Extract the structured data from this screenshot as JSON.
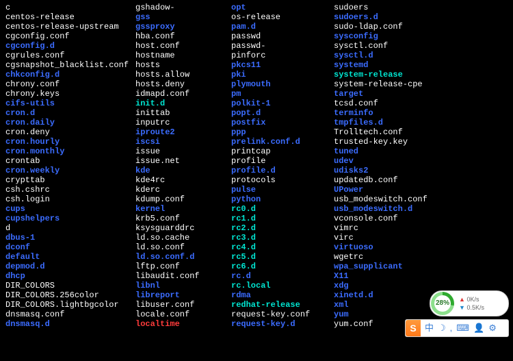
{
  "columns": [
    [
      {
        "name": "c",
        "type": "file"
      },
      {
        "name": "centos-release",
        "type": "file"
      },
      {
        "name": "centos-release-upstream",
        "type": "file"
      },
      {
        "name": "cgconfig.conf",
        "type": "file"
      },
      {
        "name": "cgconfig.d",
        "type": "dir"
      },
      {
        "name": "cgrules.conf",
        "type": "file"
      },
      {
        "name": "cgsnapshot_blacklist.conf",
        "type": "file"
      },
      {
        "name": "chkconfig.d",
        "type": "dir"
      },
      {
        "name": "chrony.conf",
        "type": "file"
      },
      {
        "name": "chrony.keys",
        "type": "file"
      },
      {
        "name": "cifs-utils",
        "type": "dir"
      },
      {
        "name": "cron.d",
        "type": "dir"
      },
      {
        "name": "cron.daily",
        "type": "dir"
      },
      {
        "name": "cron.deny",
        "type": "file"
      },
      {
        "name": "cron.hourly",
        "type": "dir"
      },
      {
        "name": "cron.monthly",
        "type": "dir"
      },
      {
        "name": "crontab",
        "type": "file"
      },
      {
        "name": "cron.weekly",
        "type": "dir"
      },
      {
        "name": "crypttab",
        "type": "file"
      },
      {
        "name": "csh.cshrc",
        "type": "file"
      },
      {
        "name": "csh.login",
        "type": "file"
      },
      {
        "name": "cups",
        "type": "dir"
      },
      {
        "name": "cupshelpers",
        "type": "dir"
      },
      {
        "name": "d",
        "type": "file"
      },
      {
        "name": "dbus-1",
        "type": "dir"
      },
      {
        "name": "dconf",
        "type": "dir"
      },
      {
        "name": "default",
        "type": "dir"
      },
      {
        "name": "depmod.d",
        "type": "dir"
      },
      {
        "name": "dhcp",
        "type": "dir"
      },
      {
        "name": "DIR_COLORS",
        "type": "file"
      },
      {
        "name": "DIR_COLORS.256color",
        "type": "file"
      },
      {
        "name": "DIR_COLORS.lightbgcolor",
        "type": "file"
      },
      {
        "name": "dnsmasq.conf",
        "type": "file"
      },
      {
        "name": "dnsmasq.d",
        "type": "dir"
      }
    ],
    [
      {
        "name": "gshadow-",
        "type": "file"
      },
      {
        "name": "gss",
        "type": "dir"
      },
      {
        "name": "gssproxy",
        "type": "dir"
      },
      {
        "name": "hba.conf",
        "type": "file"
      },
      {
        "name": "host.conf",
        "type": "file"
      },
      {
        "name": "hostname",
        "type": "file"
      },
      {
        "name": "hosts",
        "type": "file"
      },
      {
        "name": "hosts.allow",
        "type": "file"
      },
      {
        "name": "hosts.deny",
        "type": "file"
      },
      {
        "name": "idmapd.conf",
        "type": "file"
      },
      {
        "name": "init.d",
        "type": "link"
      },
      {
        "name": "inittab",
        "type": "file"
      },
      {
        "name": "inputrc",
        "type": "file"
      },
      {
        "name": "iproute2",
        "type": "dir"
      },
      {
        "name": "iscsi",
        "type": "dir"
      },
      {
        "name": "issue",
        "type": "file"
      },
      {
        "name": "issue.net",
        "type": "file"
      },
      {
        "name": "kde",
        "type": "dir"
      },
      {
        "name": "kde4rc",
        "type": "file"
      },
      {
        "name": "kderc",
        "type": "file"
      },
      {
        "name": "kdump.conf",
        "type": "file"
      },
      {
        "name": "kernel",
        "type": "dir"
      },
      {
        "name": "krb5.conf",
        "type": "file"
      },
      {
        "name": "ksysguarddrc",
        "type": "file"
      },
      {
        "name": "ld.so.cache",
        "type": "file"
      },
      {
        "name": "ld.so.conf",
        "type": "file"
      },
      {
        "name": "ld.so.conf.d",
        "type": "dir"
      },
      {
        "name": "lftp.conf",
        "type": "file"
      },
      {
        "name": "libaudit.conf",
        "type": "file"
      },
      {
        "name": "libnl",
        "type": "dir"
      },
      {
        "name": "libreport",
        "type": "dir"
      },
      {
        "name": "libuser.conf",
        "type": "file"
      },
      {
        "name": "locale.conf",
        "type": "file"
      },
      {
        "name": "localtime",
        "type": "orphan"
      }
    ],
    [
      {
        "name": "opt",
        "type": "dir"
      },
      {
        "name": "os-release",
        "type": "file"
      },
      {
        "name": "pam.d",
        "type": "dir"
      },
      {
        "name": "passwd",
        "type": "file"
      },
      {
        "name": "passwd-",
        "type": "file"
      },
      {
        "name": "pinforc",
        "type": "file"
      },
      {
        "name": "pkcs11",
        "type": "dir"
      },
      {
        "name": "pki",
        "type": "dir"
      },
      {
        "name": "plymouth",
        "type": "dir"
      },
      {
        "name": "pm",
        "type": "dir"
      },
      {
        "name": "polkit-1",
        "type": "dir"
      },
      {
        "name": "popt.d",
        "type": "dir"
      },
      {
        "name": "postfix",
        "type": "dir"
      },
      {
        "name": "ppp",
        "type": "dir"
      },
      {
        "name": "prelink.conf.d",
        "type": "dir"
      },
      {
        "name": "printcap",
        "type": "file"
      },
      {
        "name": "profile",
        "type": "file"
      },
      {
        "name": "profile.d",
        "type": "dir"
      },
      {
        "name": "protocols",
        "type": "file"
      },
      {
        "name": "pulse",
        "type": "dir"
      },
      {
        "name": "python",
        "type": "dir"
      },
      {
        "name": "rc0.d",
        "type": "link"
      },
      {
        "name": "rc1.d",
        "type": "link"
      },
      {
        "name": "rc2.d",
        "type": "link"
      },
      {
        "name": "rc3.d",
        "type": "link"
      },
      {
        "name": "rc4.d",
        "type": "link"
      },
      {
        "name": "rc5.d",
        "type": "link"
      },
      {
        "name": "rc6.d",
        "type": "link"
      },
      {
        "name": "rc.d",
        "type": "dir"
      },
      {
        "name": "rc.local",
        "type": "link"
      },
      {
        "name": "rdma",
        "type": "dir"
      },
      {
        "name": "redhat-release",
        "type": "link"
      },
      {
        "name": "request-key.conf",
        "type": "file"
      },
      {
        "name": "request-key.d",
        "type": "dir"
      }
    ],
    [
      {
        "name": "sudoers",
        "type": "file"
      },
      {
        "name": "sudoers.d",
        "type": "dir"
      },
      {
        "name": "sudo-ldap.conf",
        "type": "file"
      },
      {
        "name": "sysconfig",
        "type": "dir"
      },
      {
        "name": "sysctl.conf",
        "type": "file"
      },
      {
        "name": "sysctl.d",
        "type": "dir"
      },
      {
        "name": "systemd",
        "type": "dir"
      },
      {
        "name": "system-release",
        "type": "link"
      },
      {
        "name": "system-release-cpe",
        "type": "file"
      },
      {
        "name": "target",
        "type": "dir"
      },
      {
        "name": "tcsd.conf",
        "type": "file"
      },
      {
        "name": "terminfo",
        "type": "dir"
      },
      {
        "name": "tmpfiles.d",
        "type": "dir"
      },
      {
        "name": "Trolltech.conf",
        "type": "file"
      },
      {
        "name": "trusted-key.key",
        "type": "file"
      },
      {
        "name": "tuned",
        "type": "dir"
      },
      {
        "name": "udev",
        "type": "dir"
      },
      {
        "name": "udisks2",
        "type": "dir"
      },
      {
        "name": "updatedb.conf",
        "type": "file"
      },
      {
        "name": "UPower",
        "type": "dir"
      },
      {
        "name": "usb_modeswitch.conf",
        "type": "file"
      },
      {
        "name": "usb_modeswitch.d",
        "type": "dir"
      },
      {
        "name": "vconsole.conf",
        "type": "file"
      },
      {
        "name": "vimrc",
        "type": "file"
      },
      {
        "name": "virc",
        "type": "file"
      },
      {
        "name": "virtuoso",
        "type": "dir"
      },
      {
        "name": "wgetrc",
        "type": "file"
      },
      {
        "name": "wpa_supplicant",
        "type": "dir"
      },
      {
        "name": "X11",
        "type": "dir"
      },
      {
        "name": "xdg",
        "type": "dir"
      },
      {
        "name": "xinetd.d",
        "type": "dir"
      },
      {
        "name": "xml",
        "type": "dir"
      },
      {
        "name": "yum",
        "type": "dir"
      },
      {
        "name": "yum.conf",
        "type": "file"
      }
    ]
  ],
  "speed": {
    "percent": "28%",
    "up": "0K/s",
    "down": "0.5K/s"
  },
  "ime": {
    "logo": "S",
    "mode": "中"
  }
}
